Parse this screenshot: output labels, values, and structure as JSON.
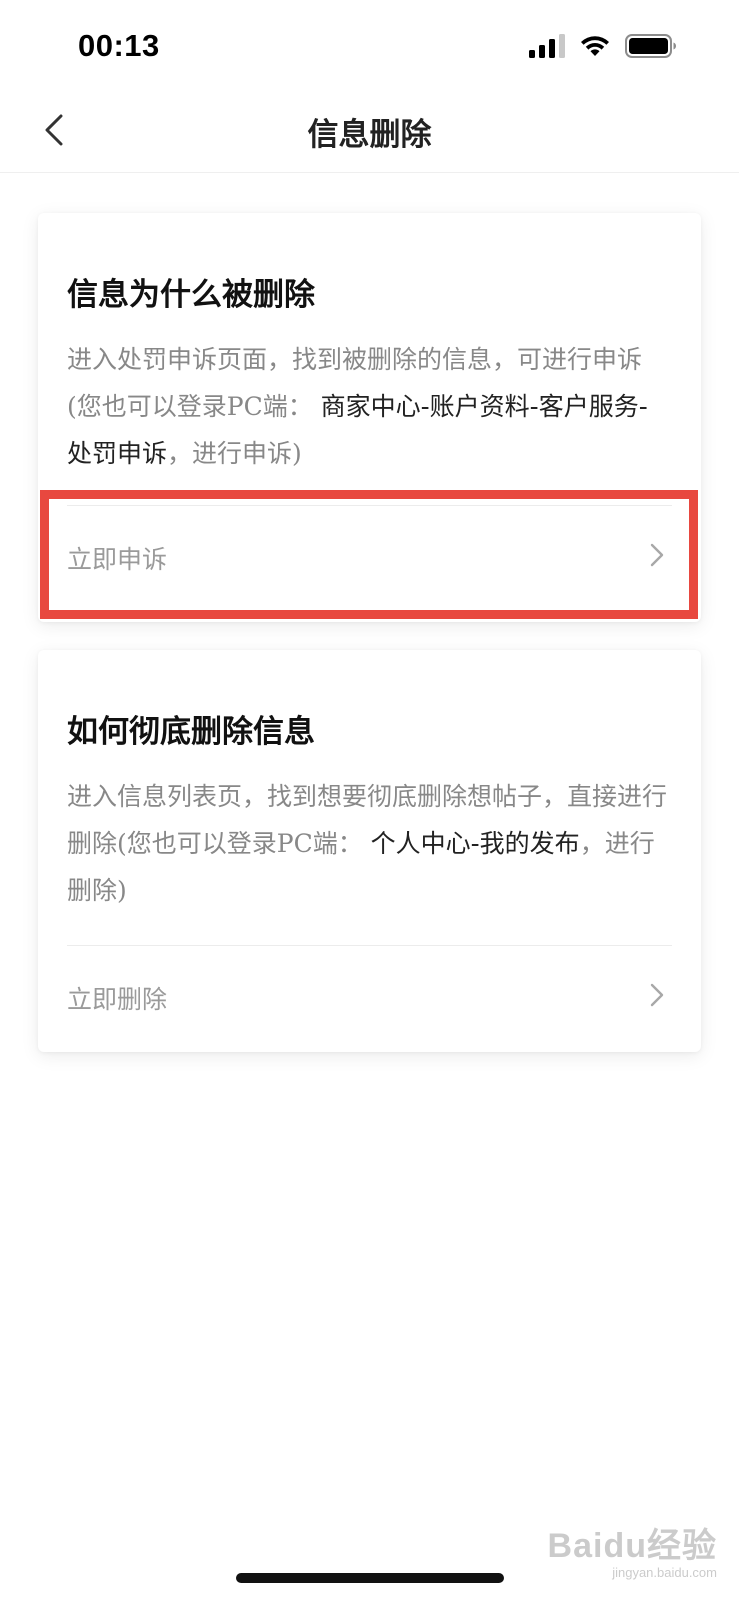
{
  "status_bar": {
    "time": "00:13",
    "icons": [
      "signal-icon",
      "wifi-icon",
      "battery-icon"
    ]
  },
  "nav": {
    "back_icon": "chevron-left-icon",
    "title": "信息删除"
  },
  "cards": [
    {
      "title": "信息为什么被删除",
      "desc_gray": "进入处罚申诉页面，找到被删除的信息，可进行申诉(您也可以登录PC端：",
      "desc_dark": " 商家中心-账户资料-客户服务-处罚申诉",
      "desc_tail": "，进行申诉)",
      "action_label": "立即申诉",
      "action_icon": "chevron-right-icon"
    },
    {
      "title": "如何彻底删除信息",
      "desc_gray": "进入信息列表页，找到想要彻底删除想帖子，直接进行删除(您也可以登录PC端：",
      "desc_dark": " 个人中心-我的发布",
      "desc_tail": "，进行删除)",
      "action_label": "立即删除",
      "action_icon": "chevron-right-icon"
    }
  ],
  "colors": {
    "highlight": "#e8483f",
    "muted_text": "#888888",
    "action_text": "#9a9a9a"
  },
  "watermark": {
    "logo": "Baidu经验",
    "sub": "jingyan.baidu.com"
  }
}
